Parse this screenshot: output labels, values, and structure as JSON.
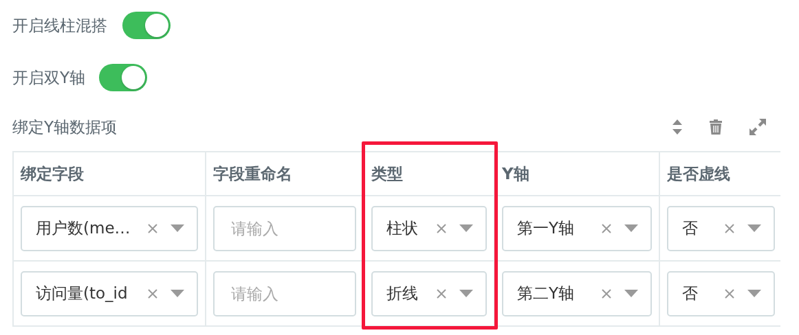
{
  "switches": [
    {
      "label": "开启线柱混搭",
      "on": true
    },
    {
      "label": "开启双Y轴",
      "on": true
    }
  ],
  "section": {
    "title": "绑定Y轴数据项"
  },
  "columns": [
    {
      "label": "绑定字段",
      "highlighted": false
    },
    {
      "label": "字段重命名",
      "highlighted": false
    },
    {
      "label": "类型",
      "highlighted": true
    },
    {
      "label": "Y轴",
      "highlighted": false
    },
    {
      "label": "是否虚线",
      "highlighted": false
    }
  ],
  "rows": [
    [
      {
        "kind": "select",
        "value": "用户数(me…"
      },
      {
        "kind": "input",
        "placeholder": "请输入"
      },
      {
        "kind": "select",
        "value": "柱状"
      },
      {
        "kind": "select",
        "value": "第一Y轴"
      },
      {
        "kind": "select",
        "value": "否"
      }
    ],
    [
      {
        "kind": "select",
        "value": "访问量(to_id"
      },
      {
        "kind": "input",
        "placeholder": "请输入"
      },
      {
        "kind": "select",
        "value": "折线"
      },
      {
        "kind": "select",
        "value": "第二Y轴"
      },
      {
        "kind": "select",
        "value": "否"
      }
    ]
  ]
}
